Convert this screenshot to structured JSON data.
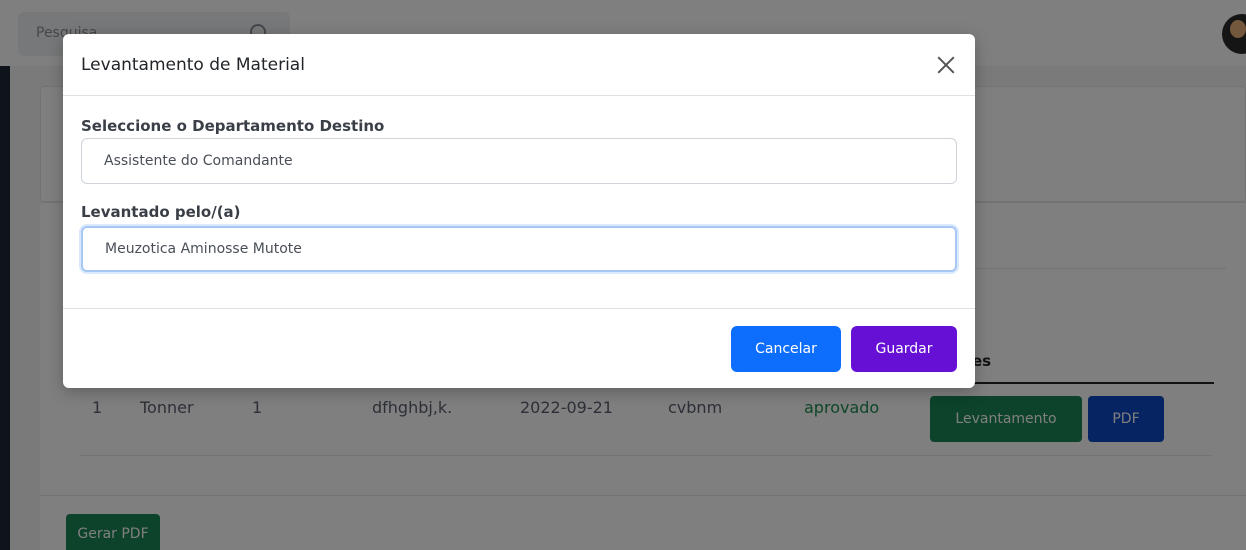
{
  "topbar": {
    "search_placeholder": "Pesquisa"
  },
  "table": {
    "actions_header_partial": "es",
    "row": {
      "index": "1",
      "material": "Tonner",
      "quantity": "1",
      "description": "dfhghbj,k.",
      "date": "2022-09-21",
      "observation": "cvbnm",
      "status": "aprovado",
      "levantamento_label": "Levantamento",
      "pdf_label": "PDF"
    }
  },
  "footer": {
    "gerar_pdf_label": "Gerar PDF"
  },
  "modal": {
    "title": "Levantamento de Material",
    "department_label": "Seleccione o Departamento Destino",
    "department_value": "Assistente do Comandante",
    "collected_by_label": "Levantado pelo/(a)",
    "collected_by_value": "Meuzotica Aminosse Mutote",
    "cancel_label": "Cancelar",
    "save_label": "Guardar"
  },
  "colors": {
    "primary": "#0d6efd",
    "save_purple": "#6610d6",
    "success": "#198754",
    "pdf_blue": "#0d47c4",
    "status_green": "#1e8c4e"
  }
}
